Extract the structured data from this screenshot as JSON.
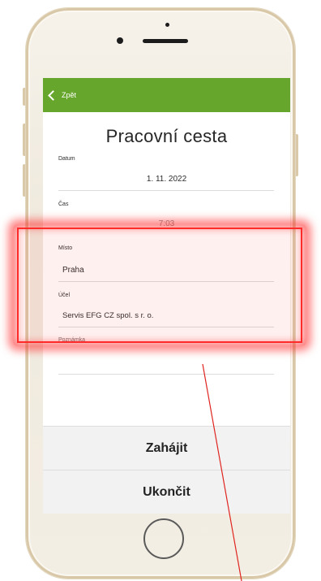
{
  "header": {
    "back_label": "Zpět"
  },
  "page": {
    "title": "Pracovní cesta"
  },
  "form": {
    "date": {
      "label": "Datum",
      "value": "1. 11. 2022"
    },
    "time": {
      "label": "Čas",
      "value": "7:03"
    },
    "place": {
      "label": "Místo",
      "value": "Praha"
    },
    "purpose": {
      "label": "Účel",
      "value": "Servis EFG CZ spol. s r. o."
    },
    "note": {
      "label": "Poznámka",
      "value": ""
    }
  },
  "actions": {
    "start_label": "Zahájit",
    "end_label": "Ukončit"
  },
  "colors": {
    "topbar": "#67a62c",
    "highlight": "#ff2a2a",
    "phone_frame": "#d8c8a8"
  },
  "icons": {
    "back": "chevron-left-icon"
  }
}
